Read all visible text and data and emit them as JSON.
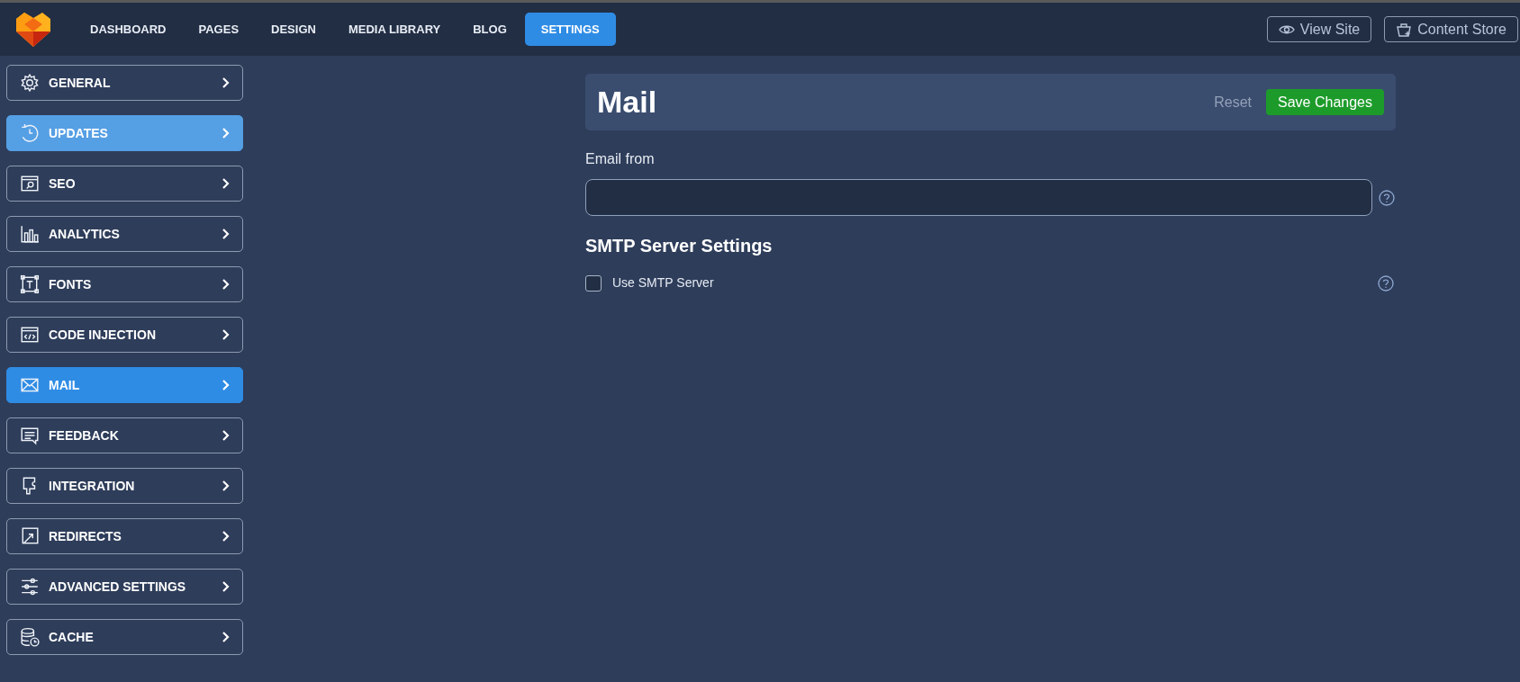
{
  "nav": {
    "items": [
      {
        "label": "DASHBOARD",
        "selected": false
      },
      {
        "label": "PAGES",
        "selected": false
      },
      {
        "label": "DESIGN",
        "selected": false
      },
      {
        "label": "MEDIA LIBRARY",
        "selected": false
      },
      {
        "label": "BLOG",
        "selected": false
      },
      {
        "label": "SETTINGS",
        "selected": true
      }
    ],
    "actions": [
      {
        "label": "View Site"
      },
      {
        "label": "Content Store"
      }
    ]
  },
  "sidebar": {
    "items": [
      {
        "label": "GENERAL",
        "selected": false,
        "hovered": false
      },
      {
        "label": "UPDATES",
        "selected": false,
        "hovered": true
      },
      {
        "label": "SEO",
        "selected": false,
        "hovered": false
      },
      {
        "label": "ANALYTICS",
        "selected": false,
        "hovered": false
      },
      {
        "label": "FONTS",
        "selected": false,
        "hovered": false
      },
      {
        "label": "CODE INJECTION",
        "selected": false,
        "hovered": false
      },
      {
        "label": "MAIL",
        "selected": true,
        "hovered": false
      },
      {
        "label": "FEEDBACK",
        "selected": false,
        "hovered": false
      },
      {
        "label": "INTEGRATION",
        "selected": false,
        "hovered": false
      },
      {
        "label": "REDIRECTS",
        "selected": false,
        "hovered": false
      },
      {
        "label": "ADVANCED SETTINGS",
        "selected": false,
        "hovered": false
      },
      {
        "label": "CACHE",
        "selected": false,
        "hovered": false
      }
    ]
  },
  "panel": {
    "title": "Mail",
    "reset": "Reset",
    "save": "Save Changes",
    "email_from": {
      "label": "Email from"
    },
    "smtp": {
      "heading": "SMTP Server Settings",
      "use_smtp": {
        "label": "Use SMTP Server",
        "checked": false
      }
    }
  }
}
